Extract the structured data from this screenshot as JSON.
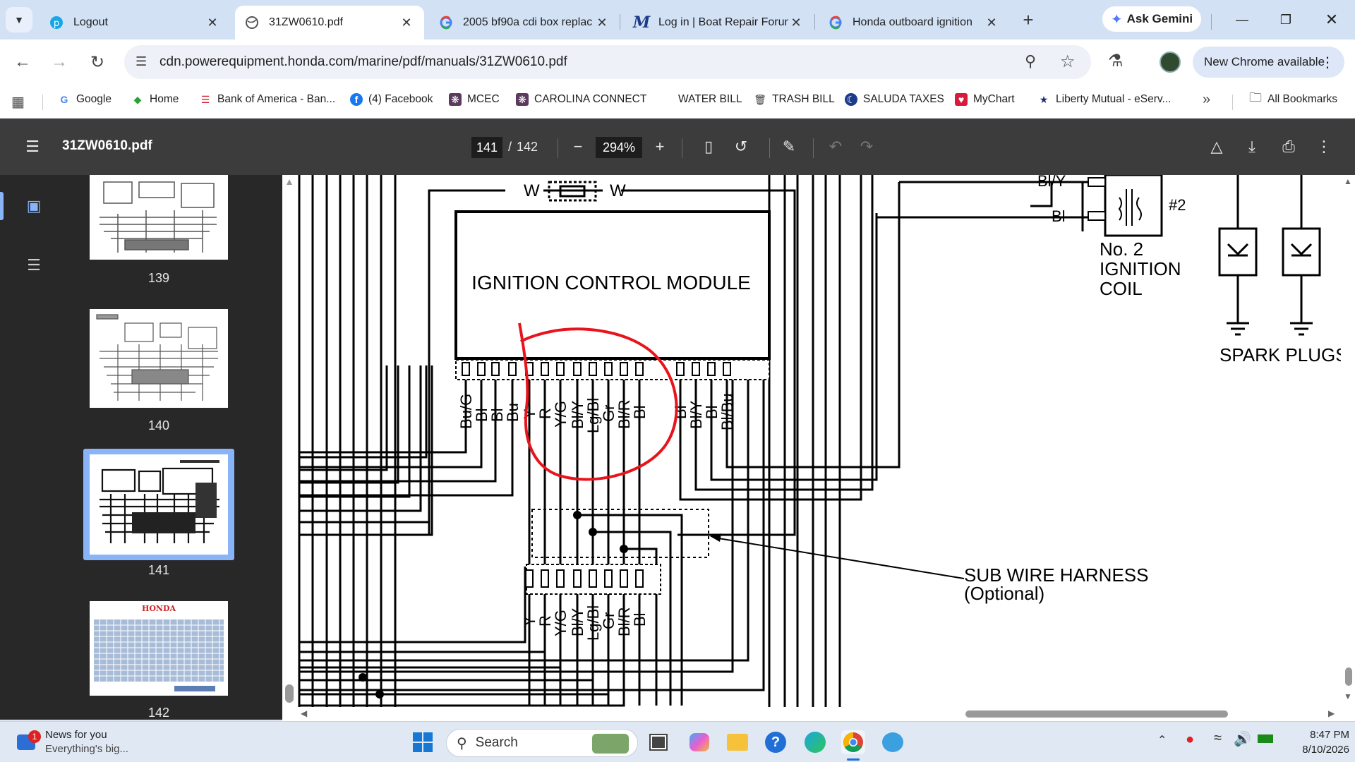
{
  "tabs": [
    {
      "title": "Logout",
      "icon": "pcloud-icon"
    },
    {
      "title": "31ZW0610.pdf",
      "icon": "globe-icon"
    },
    {
      "title": "2005 bf90a cdi box replac",
      "icon": "google-icon"
    },
    {
      "title": "Log in | Boat Repair Forun",
      "icon": "m-logo-icon"
    },
    {
      "title": "Honda outboard ignition",
      "icon": "google-icon"
    }
  ],
  "gemini_label": "Ask Gemini",
  "url": "cdn.powerequipment.honda.com/marine/pdf/manuals/31ZW0610.pdf",
  "new_chrome_label": "New Chrome available",
  "bookmarks": [
    {
      "label": "Google",
      "icon": "google-icon"
    },
    {
      "label": "Home",
      "icon": "home-icon"
    },
    {
      "label": "Bank of America - Ban...",
      "icon": "boa-icon"
    },
    {
      "label": "(4) Facebook",
      "icon": "facebook-icon"
    },
    {
      "label": "MCEC",
      "icon": "mcec-icon"
    },
    {
      "label": "CAROLINA CONNECT",
      "icon": "carolina-icon"
    },
    {
      "label": "WATER BILL",
      "icon": "blank-icon"
    },
    {
      "label": "TRASH BILL",
      "icon": "trash-icon"
    },
    {
      "label": "SALUDA TAXES",
      "icon": "saluda-icon"
    },
    {
      "label": "MyChart",
      "icon": "mychart-icon"
    },
    {
      "label": "Liberty Mutual - eServ...",
      "icon": "liberty-icon"
    }
  ],
  "all_bookmarks_label": "All Bookmarks",
  "pdf": {
    "file_name": "31ZW0610.pdf",
    "current_page": "141",
    "page_sep": "/",
    "total_pages": "142",
    "zoom": "294%",
    "thumbnails": [
      "139",
      "140",
      "141",
      "142"
    ]
  },
  "diagram": {
    "module_label": "IGNITION CONTROL MODULE",
    "fuse_label_left": "W",
    "fuse_label_right": "W",
    "module_pins_left": [
      "Bu/G",
      "Bl",
      "Bl",
      "Bu"
    ],
    "module_pins_mid": [
      "Y",
      "R",
      "Y/G",
      "Bl/Y",
      "Lg/Bl",
      "Gr",
      "Bl/R",
      "Bl"
    ],
    "module_pins_right": [
      "Bl",
      "Bl/Y",
      "Bl",
      "Bl/Bu"
    ],
    "harness_pins": [
      "Y",
      "R",
      "Y/G",
      "Bl/Y",
      "Lg/Bl",
      "Gr",
      "Bl/R",
      "Bl"
    ],
    "sub_harness_line1": "SUB WIRE HARNESS",
    "sub_harness_line2": "(Optional)",
    "coil_line1": "No. 2",
    "coil_line2": "IGNITION",
    "coil_line3": "COIL",
    "coil_pin_top": "Bl/Y",
    "coil_pin_bottom": "Bl",
    "coil_num": "#2",
    "spark_plugs": "SPARK PLUGS",
    "annotation_color": "#e8141c"
  },
  "taskbar": {
    "news_title": "News for you",
    "news_sub": "Everything's big...",
    "news_badge": "1",
    "search_label": "Search",
    "time": "8:47 PM",
    "date": "8/10/2026"
  }
}
